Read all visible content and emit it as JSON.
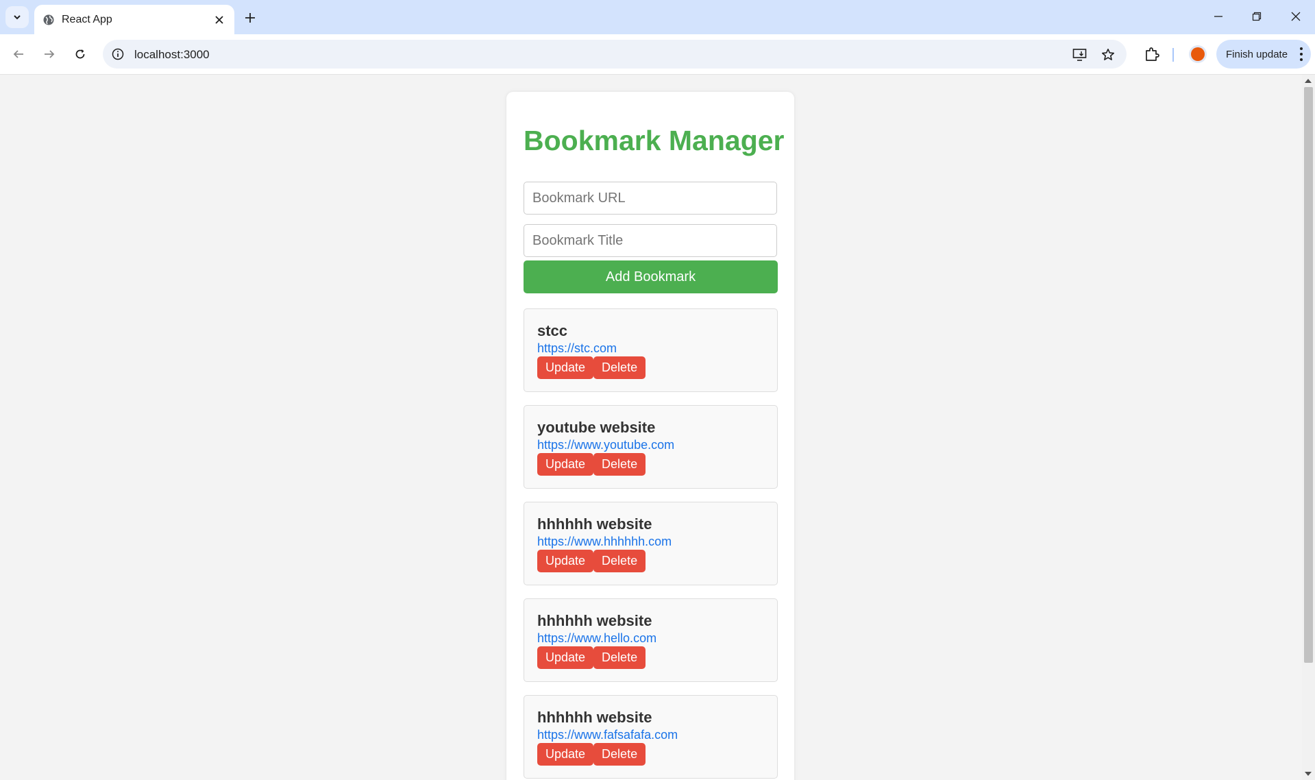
{
  "browser": {
    "tab_title": "React App",
    "url": "localhost:3000",
    "finish_update_label": "Finish update"
  },
  "app": {
    "title": "Bookmark Manager",
    "url_placeholder": "Bookmark URL",
    "title_placeholder": "Bookmark Title",
    "add_button": "Add Bookmark",
    "update_label": "Update",
    "delete_label": "Delete",
    "bookmarks": [
      {
        "title": "stcc",
        "url": "https://stc.com"
      },
      {
        "title": "youtube website",
        "url": "https://www.youtube.com"
      },
      {
        "title": "hhhhhh website",
        "url": "https://www.hhhhhh.com"
      },
      {
        "title": "hhhhhh website",
        "url": "https://www.hello.com"
      },
      {
        "title": "hhhhhh website",
        "url": "https://www.fafsafafa.com"
      }
    ]
  },
  "colors": {
    "accent_green": "#4caf50",
    "danger_red": "#e74c3c",
    "link_blue": "#1a73e8"
  },
  "icons": {
    "tab_search": "chevron-down-icon",
    "favicon": "globe-icon",
    "tab_close": "close-icon",
    "new_tab": "plus-icon",
    "back": "arrow-left-icon",
    "forward": "arrow-right-icon",
    "reload": "reload-icon",
    "site_info": "info-icon",
    "install": "install-app-icon",
    "bookmark_star": "star-icon",
    "extensions": "puzzle-icon",
    "menu": "kebab-menu-icon"
  }
}
